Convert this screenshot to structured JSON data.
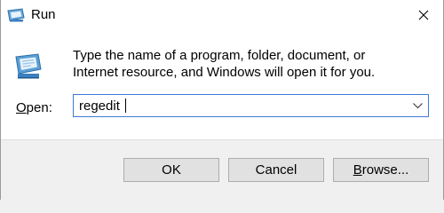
{
  "window": {
    "title": "Run",
    "icon": "run-icon",
    "close_icon": "close-icon"
  },
  "dialog": {
    "message_line1": "Type the name of a program, folder, document, or",
    "message_line2": "Internet resource, and Windows will open it for you.",
    "open_label_mnemonic": "O",
    "open_label_rest": "pen:",
    "open_value": "regedit",
    "accent_color": "#3e7bd6"
  },
  "buttons": {
    "ok_label": "OK",
    "cancel_label": "Cancel",
    "browse_mnemonic": "B",
    "browse_rest": "rowse..."
  }
}
